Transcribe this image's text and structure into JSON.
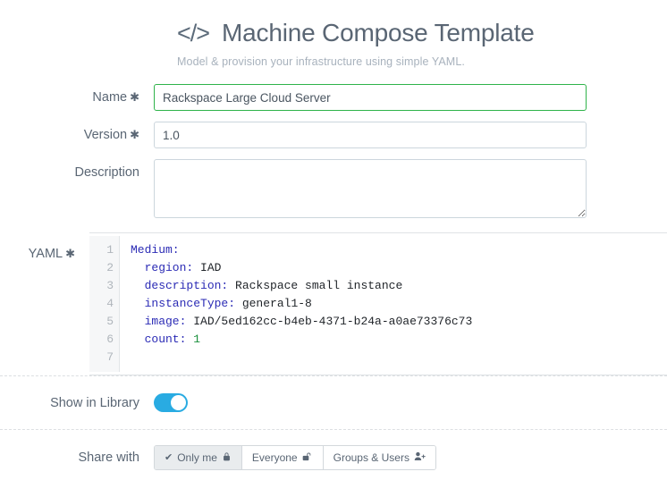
{
  "header": {
    "code_icon": "</>",
    "title": "Machine Compose Template",
    "subtitle": "Model & provision your infrastructure using simple YAML."
  },
  "form": {
    "required_mark": "✱",
    "name": {
      "label": "Name",
      "required": true,
      "value": "Rackspace Large Cloud Server",
      "placeholder": "",
      "focused": true
    },
    "version": {
      "label": "Version",
      "required": true,
      "value": "1.0",
      "placeholder": ""
    },
    "description": {
      "label": "Description",
      "required": false,
      "value": "",
      "placeholder": ""
    },
    "yaml": {
      "label": "YAML",
      "required": true,
      "line_numbers": [
        "1",
        "2",
        "3",
        "4",
        "5",
        "6",
        "7"
      ],
      "lines": [
        {
          "key": "Medium",
          "sep": ":",
          "value": "",
          "indent": 0,
          "value_kind": "none"
        },
        {
          "key": "region",
          "sep": ":",
          "value": " IAD",
          "indent": 1,
          "value_kind": "plain"
        },
        {
          "key": "description",
          "sep": ":",
          "value": " Rackspace small instance",
          "indent": 1,
          "value_kind": "plain"
        },
        {
          "key": "instanceType",
          "sep": ":",
          "value": " general1-8",
          "indent": 1,
          "value_kind": "plain"
        },
        {
          "key": "image",
          "sep": ":",
          "value": " IAD/5ed162cc-b4eb-4371-b24a-a0ae73376c73",
          "indent": 1,
          "value_kind": "plain"
        },
        {
          "key": "count",
          "sep": ":",
          "value": " 1",
          "indent": 1,
          "value_kind": "number"
        },
        {
          "key": "",
          "sep": "",
          "value": "",
          "indent": 0,
          "value_kind": "none"
        }
      ]
    }
  },
  "library": {
    "label": "Show in Library",
    "enabled": true
  },
  "share": {
    "label": "Share with",
    "options": [
      {
        "label": "Only me",
        "icon": "lock-closed-icon",
        "glyph": "🔒",
        "selected": true,
        "check": "✔"
      },
      {
        "label": "Everyone",
        "icon": "lock-open-icon",
        "glyph": "🔓",
        "selected": false,
        "check": ""
      },
      {
        "label": "Groups & Users",
        "icon": "user-plus-icon",
        "glyph": "👥",
        "selected": false,
        "check": ""
      }
    ]
  },
  "colors": {
    "focus_border": "#2fb34a",
    "toggle_on": "#29abe2",
    "yaml_key": "#2b2bb5",
    "yaml_number": "#1a8f3c",
    "text": "#5a6674"
  }
}
